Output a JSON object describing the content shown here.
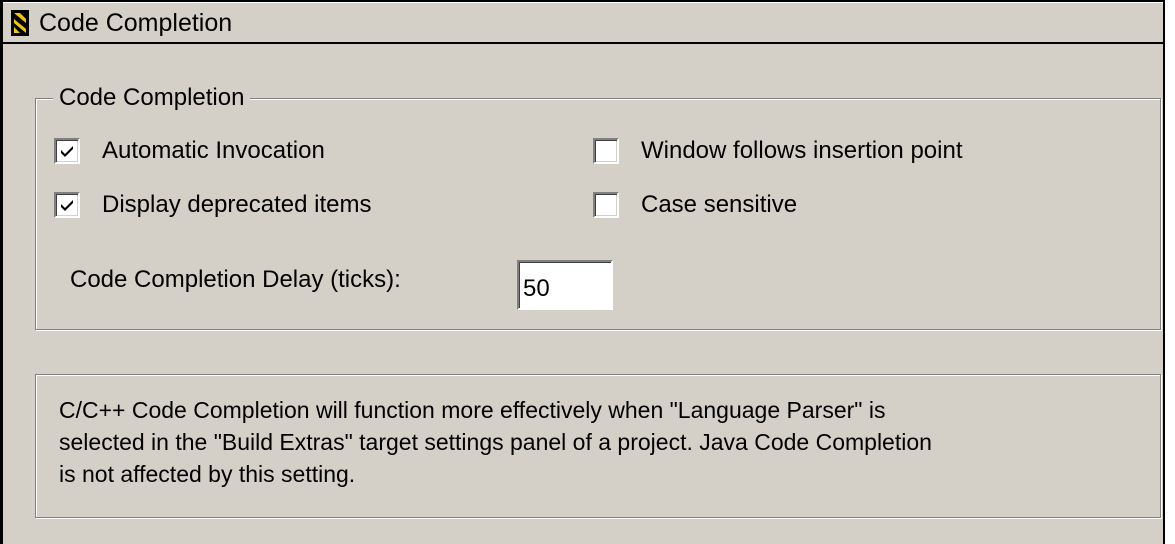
{
  "window": {
    "title": "Code Completion"
  },
  "group": {
    "legend": "Code Completion",
    "checkboxes": [
      {
        "label": "Automatic Invocation",
        "checked": true
      },
      {
        "label": "Display deprecated items",
        "checked": true
      },
      {
        "label": "Window follows insertion point",
        "checked": false
      },
      {
        "label": "Case sensitive",
        "checked": false
      }
    ],
    "delay": {
      "label": "Code Completion Delay (ticks):",
      "value": "50"
    }
  },
  "note": {
    "lines": [
      "C/C++ Code Completion will function more effectively when \"Language Parser\" is",
      "selected in the \"Build Extras\" target settings panel of a project.  Java Code Completion",
      "is not affected by this setting."
    ]
  },
  "colors": {
    "background": "#d4d0c8",
    "shadow": "#808080",
    "highlight": "#ffffff",
    "icon_yellow": "#f0c800"
  }
}
